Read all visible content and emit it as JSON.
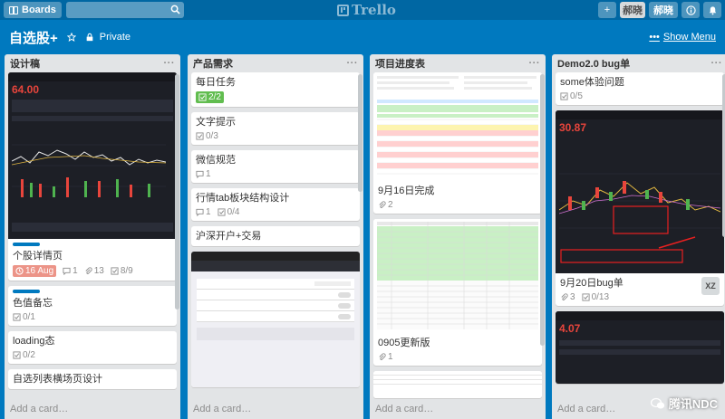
{
  "header": {
    "boards_label": "Boards",
    "search_placeholder": "",
    "logo_text": "Trello",
    "add_label": "+",
    "avatar_text": "郝晓",
    "user_name": "郝晓",
    "info_label": "i",
    "bell_label": "♪"
  },
  "board": {
    "title": "自选股+",
    "privacy": "Private",
    "show_menu": "Show Menu"
  },
  "lists": [
    {
      "title": "设计稿",
      "cards": [
        {
          "title": "个股详情页",
          "due": "16 Aug",
          "comments": "1",
          "attachments": "13",
          "checklist": "8/9"
        },
        {
          "title": "色值备忘",
          "checklist": "0/1"
        },
        {
          "title": "loading态",
          "checklist": "0/2"
        },
        {
          "title": "自选列表横场页设计"
        }
      ],
      "add_card": "Add a card…"
    },
    {
      "title": "产品需求",
      "cards": [
        {
          "title": "每日任务",
          "checklist": "2/2"
        },
        {
          "title": "文字提示",
          "checklist": "0/3"
        },
        {
          "title": "微信规范",
          "comments": "1"
        },
        {
          "title": "行情tab板块结构设计",
          "comments": "1",
          "checklist": "0/4"
        },
        {
          "title": "沪深开户+交易"
        }
      ],
      "add_card": "Add a card…"
    },
    {
      "title": "项目进度表",
      "cards": [
        {
          "title": "9月16日完成",
          "attachments": "2"
        },
        {
          "title": "0905更新版",
          "attachments": "1"
        }
      ],
      "add_card": "Add a card…"
    },
    {
      "title": "Demo2.0 bug单",
      "cards": [
        {
          "title": "some体验问题",
          "checklist": "0/5"
        },
        {
          "title": "9月20日bug单",
          "attachments": "3",
          "checklist": "0/13",
          "member": "XZ"
        }
      ],
      "add_card": "Add a card…"
    }
  ],
  "mock": {
    "phone1_price": "64.00",
    "phone2_price": "30.87",
    "phone3_price": "4.07"
  },
  "watermark": "腾讯NDC"
}
